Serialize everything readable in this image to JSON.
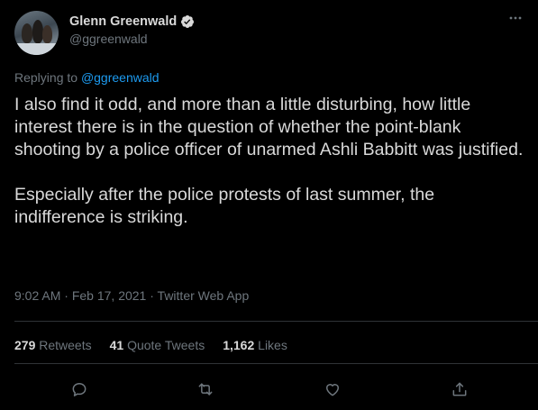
{
  "author": {
    "name": "Glenn Greenwald",
    "handle": "@ggreenwald",
    "verified": true
  },
  "reply": {
    "prefix": "Replying to",
    "target": "@ggreenwald"
  },
  "tweet": {
    "text": "I also find it odd, and more than a little disturbing, how little interest there is in the question of whether the point-blank shooting by a police officer of unarmed Ashli Babbitt was justified.\n\nEspecially after the police protests of last summer, the indifference is striking."
  },
  "meta": {
    "time": "9:02 AM",
    "date": "Feb 17, 2021",
    "source": "Twitter Web App",
    "dot": "·"
  },
  "stats": {
    "retweets": {
      "count": "279",
      "label": "Retweets"
    },
    "quotes": {
      "count": "41",
      "label": "Quote Tweets"
    },
    "likes": {
      "count": "1,162",
      "label": "Likes"
    }
  },
  "colors": {
    "background": "#000000",
    "text": "#d9d9d9",
    "muted": "#6e767d",
    "link": "#1d9bf0",
    "divider": "#2f3336"
  },
  "icons": [
    "verified-badge-icon",
    "more-icon",
    "reply-icon",
    "retweet-icon",
    "like-icon",
    "share-icon"
  ]
}
